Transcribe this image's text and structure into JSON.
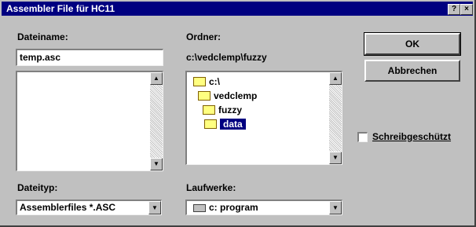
{
  "window": {
    "title": "Assembler File für HC11",
    "help_label": "?",
    "close_label": "×"
  },
  "filename": {
    "label_pre": "Dateiname",
    "label_post": ":",
    "value": "temp.asc"
  },
  "folder": {
    "label_pre": "Ordner",
    "label_post": ":",
    "path": "c:\\vedclemp\\fuzzy",
    "tree": [
      {
        "label": "c:\\",
        "selected": false
      },
      {
        "label": "vedclemp",
        "selected": false
      },
      {
        "label": "fuzzy",
        "selected": false
      },
      {
        "label": "data",
        "selected": true
      }
    ]
  },
  "buttons": {
    "ok": "OK",
    "cancel": "Abbrechen"
  },
  "readonly": {
    "label": "Schreibgeschützt",
    "checked": false
  },
  "filetype": {
    "label_pre": "Dateityp",
    "label_post": ":",
    "value": "Assemblerfiles *.ASC"
  },
  "drives": {
    "label_pre": "Laufwerke",
    "label_post": ":",
    "value": "c:  program"
  },
  "icons": {
    "scroll_up": "▲",
    "scroll_down": "▼",
    "dropdown": "▼"
  }
}
